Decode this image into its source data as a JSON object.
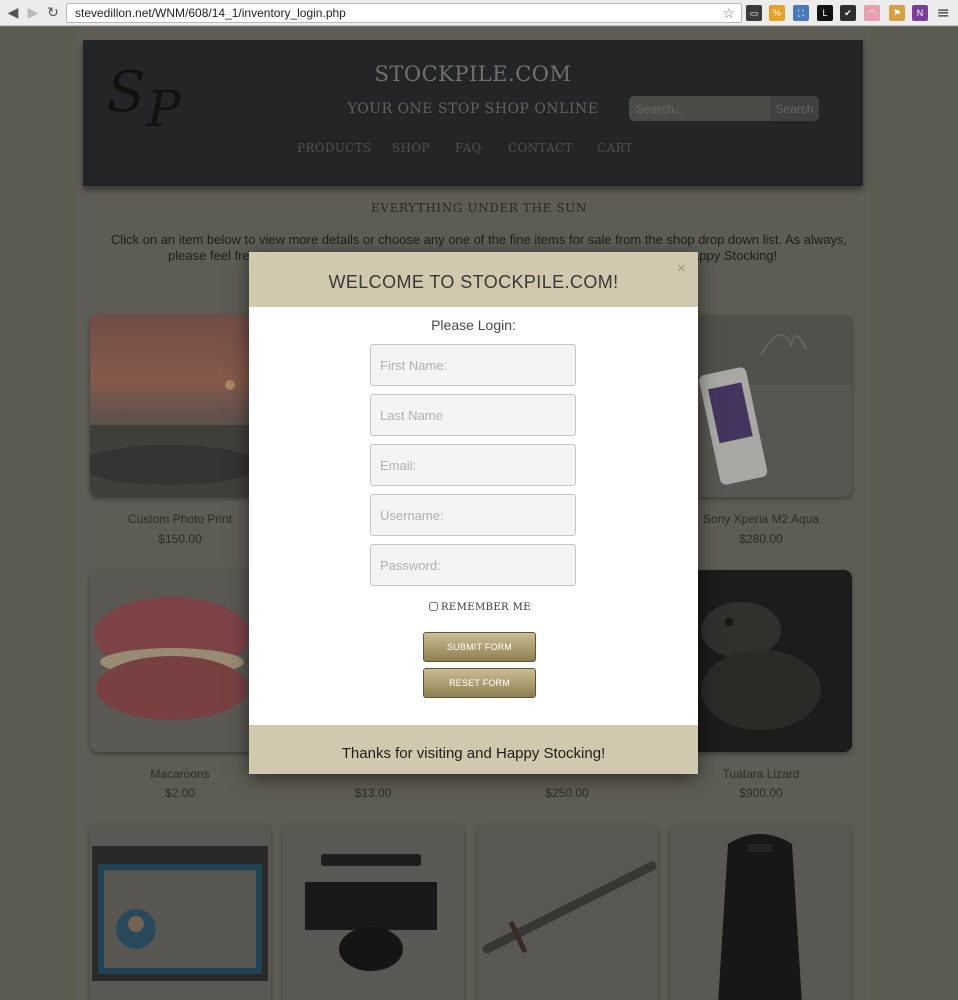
{
  "browser": {
    "url_domain": "stevedillon.net",
    "url_path": "/WNM/608/14_1/inventory_login.php"
  },
  "site": {
    "title": "STOCKPILE.COM",
    "tagline": "YOUR ONE STOP SHOP ONLINE",
    "search_placeholder": "Search...",
    "search_button": "Search",
    "menu": [
      "PRODUCTS",
      "SHOP",
      "FAQ",
      "CONTACT",
      "CART"
    ],
    "subtitle": "EVERYTHING UNDER THE SUN",
    "intro_line1": "Click on an item below to view more details or choose any one of the fine items for sale from the shop drop down list. As always,",
    "intro_line2_left": "please feel free",
    "intro_line2_right": "appy Stocking!"
  },
  "products": [
    {
      "name": "Custom Photo Print",
      "price": "$150.00"
    },
    {
      "name": "Sony Xperia M2 Aqua",
      "price": "$280.00"
    },
    {
      "name": "Macaroons",
      "price": "$2.00"
    },
    {
      "name": "Tuatara Lizard",
      "price": "$900.00"
    }
  ],
  "hidden_prices": [
    "$13.00",
    "$250.00"
  ],
  "modal": {
    "title": "WELCOME TO STOCKPILE.COM!",
    "close": "×",
    "subtitle": "Please Login:",
    "first_name_placeholder": "First Name:",
    "last_name_placeholder": "Last Name",
    "email_placeholder": "Email:",
    "username_placeholder": "Username:",
    "password_placeholder": "Password:",
    "remember_label": "REMEMBER ME",
    "submit_label": "SUBMIT FORM",
    "reset_label": "RESET FORM",
    "footer": "Thanks for visiting and Happy Stocking!"
  },
  "colors": {
    "header_bg": "#232427",
    "modal_band": "#d0c9af",
    "button_gold": "#a8996a"
  }
}
